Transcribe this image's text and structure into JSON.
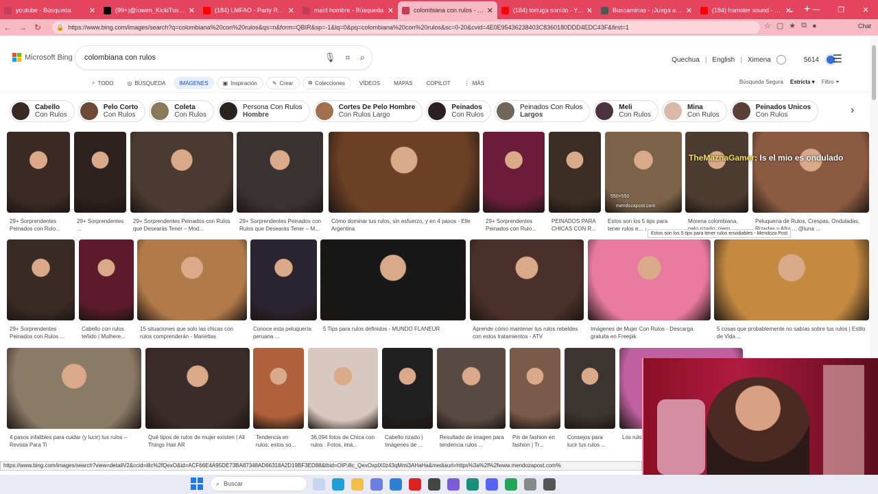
{
  "browser": {
    "tabs": [
      {
        "title": "youtube - Búsqueda",
        "icon_color": "#c43c5a",
        "active": false
      },
      {
        "title": "(99+)@iowen_KickiTusOwe...",
        "icon_color": "#000000",
        "active": false
      },
      {
        "title": "(184) LMFAO - Party Rock An...",
        "icon_color": "#ff0000",
        "active": false
      },
      {
        "title": "maid hombre - Búsqueda",
        "icon_color": "#c43c5a",
        "active": false
      },
      {
        "title": "colombiana con rulos - Búsq...",
        "icon_color": "#c43c5a",
        "active": true
      },
      {
        "title": "(184) tortuga sonido - YouTu...",
        "icon_color": "#ff0000",
        "active": false
      },
      {
        "title": "Buscaminas - ¡Juega ahora!",
        "icon_color": "#555555",
        "active": false
      },
      {
        "title": "(184) hamster sound - YouTu...",
        "icon_color": "#ff0000",
        "active": false
      }
    ],
    "new_tab": "+",
    "window_controls": [
      "⌄",
      "—",
      "❐",
      "✕"
    ],
    "url": "https://www.bing.com/images/search?q=colombiana%20con%20rulos&qs=n&form=QBIR&sp=-1&lq=0&pq=colombiana%20con%20rulos&sc=0-20&cvid=4E0E95436238403C8360180DDD4EDC43F&first=1",
    "chat_label": "Chat"
  },
  "bing": {
    "logo_text": "Microsoft Bing",
    "query": "colombiana con rulos",
    "lang1": "Quechua",
    "lang2": "English",
    "user": "Ximena",
    "points": "5614",
    "scopes": [
      "TODO",
      "BÚSQUEDA",
      "IMÁGENES",
      "Inspiración",
      "Crear",
      "Colecciones",
      "VÍDEOS",
      "MAPAS",
      "COPILOT",
      "MÁS"
    ],
    "safe_label": "Búsqueda Segura",
    "safe_value": "Estricta",
    "filter_label": "Filtro"
  },
  "chips": [
    {
      "l1": "Cabello",
      "l2": "Con Rulos",
      "alt": false,
      "thumb": "#3a2a24"
    },
    {
      "l1": "Pelo Corto",
      "l2": "Con Rulos",
      "alt": false,
      "thumb": "#6e4a36"
    },
    {
      "l1": "Coleta",
      "l2": "Con Rulos",
      "alt": false,
      "thumb": "#8a7a5a"
    },
    {
      "l1": "Persona Con Rulos",
      "l2": "Hombre",
      "alt": true,
      "thumb": "#2b2320"
    },
    {
      "l1": "Cortes De Pelo Hombre",
      "l2": "Con Rulos Largo",
      "alt": false,
      "thumb": "#a07050"
    },
    {
      "l1": "Peinados",
      "l2": "Con Rulos",
      "alt": false,
      "thumb": "#2a1f22"
    },
    {
      "l1": "Peinados Con Rulos",
      "l2": "Largos",
      "alt": true,
      "thumb": "#70665a"
    },
    {
      "l1": "Meli",
      "l2": "Con Rulos",
      "alt": false,
      "thumb": "#4a3240"
    },
    {
      "l1": "Mina",
      "l2": "Con Rulos",
      "alt": false,
      "thumb": "#d9b8a8"
    },
    {
      "l1": "Peinados Unicos",
      "l2": "Con Rulos",
      "alt": false,
      "thumb": "#5a4036"
    }
  ],
  "results_row1": [
    {
      "cap": "29+ Sorprendentes Peinados con Rulo...",
      "color": "#3b2a24"
    },
    {
      "cap": "29+ Sorprendentes ...",
      "color": "#2c2220"
    },
    {
      "cap": "29+ Sorprendentes Peinados con Rulos que Desearás Tener – Mod...",
      "color": "#4a3a30"
    },
    {
      "cap": "29+ Sorprendentes Peinados con Rulos que Desearás Tener – M...",
      "color": "#3a3230"
    },
    {
      "cap": "Cómo dominar tus rulos, sin esfuerzo, y en 4 pasos - Elle Argentina",
      "color": "#6b4026"
    },
    {
      "cap": "29+ Sorprendentes Peinados con Rulo...",
      "color": "#6a1c3a"
    },
    {
      "cap": "PEINADOS PARA CHICAS CON R...",
      "color": "#3c2e24"
    },
    {
      "cap": "Estos son los 5 tips para tener rulos e... ↓",
      "color": "#7b6248"
    },
    {
      "cap": "Morena colombiana, pelo rizado, piern...",
      "color": "#4e3c30"
    },
    {
      "cap": "Peluquería de Rulos, Crespas, Onduladas, Rizadas y Afro ... @luna ...",
      "color": "#8c5a42"
    }
  ],
  "size_badge": "550×550",
  "source_badge": "mendozapost.com",
  "overlay_user": "TheMaznaGamer",
  "overlay_text": ": Is el mio es ondulado",
  "tooltip": "Estos son los 5 tips para tener rulos envidiables - Mendoza Post",
  "results_row2": [
    {
      "cap": "29+ Sorprendentes Peinados con Rulos ...",
      "color": "#3a2a26"
    },
    {
      "cap": "Cabello con rulos teñido | Mulhere...",
      "color": "#5c1a2c"
    },
    {
      "cap": "15 situaciones que solo las chicas con rulos comprenderán - Mariettas",
      "color": "#b07a4a"
    },
    {
      "cap": "Conoce esta peluquería peruana ...",
      "color": "#2a2430"
    },
    {
      "cap": "5 Tips para rulos definidos - MUNDO FLANEUR",
      "color": "#181818"
    },
    {
      "cap": "Aprende cómo mantener tus rulos rebeldes con estos tratamientos - ATV",
      "color": "#4a3028"
    },
    {
      "cap": "Imágenes de Mujer Con Rulos - Descarga gratuita en Freepik",
      "color": "#e87aa0"
    },
    {
      "cap": "5 cosas que probablemente no sabías sobre tus rulos | Estilo de Vida ...",
      "color": "#c48a40"
    }
  ],
  "results_row3": [
    {
      "cap": "4 pasos infalibles para cuidar (y lucir) tus rulos – Revista Para Ti",
      "color": "#8a7a66"
    },
    {
      "cap": "Qué tipos de rulos de mujer existen | All Things Hair AR",
      "color": "#3a2c28"
    },
    {
      "cap": "Tendencia en rulos: estos so...",
      "color": "#b0603a"
    },
    {
      "cap": "36,094 fotos de Chica con rulos . Fotos, imá...",
      "color": "#d8c8c0"
    },
    {
      "cap": "Cabello rizado | Imágenes de ...",
      "color": "#202020"
    },
    {
      "cap": "Resultado de imagen para tendencia rulos ...",
      "color": "#5a4a44"
    },
    {
      "cap": "Pin de fashion en fashion | Tr...",
      "color": "#7a5a48"
    },
    {
      "cap": "Consejos para lucir tus rulos ...",
      "color": "#3c3430"
    },
    {
      "cap": "Los rulo usarlos",
      "color": "#c060a0"
    }
  ],
  "status_url": "https://www.bing.com/images/search?view=detailV2&ccid=i8c%2fQexO&id=ACF66E4A95DE73BA87348AD66318A2D19BF3ED88&thid=OIP.i8c_QexOxplX0z43qMmi3AHaHa&mediaurl=https%3a%2f%2fwww.mendozapost.com%",
  "taskbar": {
    "search_placeholder": "Buscar"
  }
}
